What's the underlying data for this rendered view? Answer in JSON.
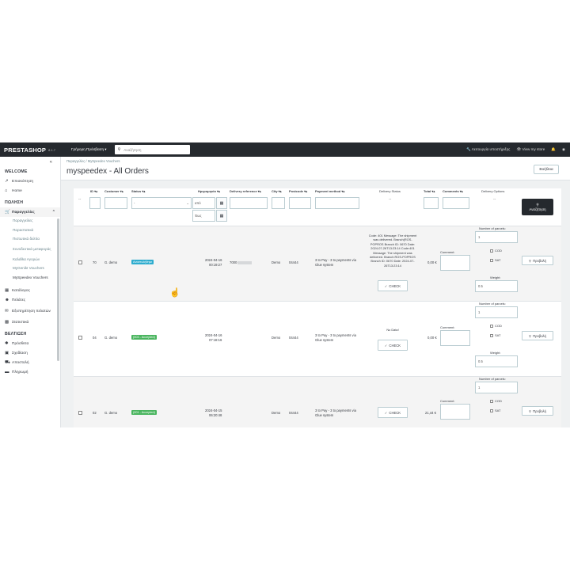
{
  "topbar": {
    "logo": "PRESTASHOP",
    "version": "8.1.7",
    "quick_access": "Γρήγορη Πρόσβαση ▾",
    "search_placeholder": "Αναζήτηση",
    "maintenance": "Λειτουργία υποστήριξης",
    "view_store": "View my store"
  },
  "sidebar": {
    "welcome": "WELCOME",
    "dashboard": "Επισκόπηση",
    "home": "Home",
    "sales": "ΠΩΛΗΣΗ",
    "orders": "Παραγγελίες",
    "order_subs": [
      "Παραγγελίες",
      "Παραστατικά",
      "Πιστωτικά δελτία",
      "Συνοδευτικά μεταφοράς",
      "Καλάθια Αγορών",
      "MyGenikI Vouchers",
      "MySpeedex Vouchers"
    ],
    "catalog": "Κατάλογος",
    "customers": "Πελάτες",
    "customer_service": "Εξυπηρέτηση πελατών",
    "stats": "Στατιστικά",
    "improve": "ΒΕΛΤΙΩΣΗ",
    "modules": "Πρόσθετα",
    "design": "Σχεδίαση",
    "shipping": "Αποστολή",
    "payment": "Πληρωμή"
  },
  "header": {
    "breadcrumb_1": "Παραγγελίες",
    "breadcrumb_2": "MySpeedex Vouchers",
    "title": "myspeedex - All Orders",
    "back": "Βοήθεια"
  },
  "table": {
    "columns": [
      "ID ▾▴",
      "Customer ▾▴",
      "Status ▾▴",
      "Ημερομηνία ▾▴",
      "Delivery reference ▾▴",
      "City ▾▴",
      "Postcode ▾▴",
      "Payment method ▾▴",
      "Delivery Status",
      "Total ▾▴",
      "Comments ▾▴",
      "Delivery Options"
    ],
    "filters": {
      "status_placeholder": "-",
      "date_from": "από",
      "date_to": "Έως",
      "dash": "--",
      "search_label": "Αναζήτηση"
    },
    "rows": [
      {
        "id": "70",
        "customer": "G. demo",
        "status": "Αναστολήθηκε",
        "date": "2024-04-16",
        "time": "00:19:27",
        "ref": "7000",
        "city": "Demo",
        "postcode": "04444",
        "payment_1": "3 to Pay - 3 to payments via",
        "payment_2": "Glue system",
        "delivery_status": [
          "Code: 401 Message: The shipment",
          "was delivered. Branch(ROS-",
          "POPROS Branch ID: 0670 Date:",
          "2024-07-26T13:23:14 Code:401",
          "Message: The shipment was",
          "delivered. Branch:ROS-POPROS",
          "Branch ID: 0670 Date: 2024-07-",
          "26T13:23:14"
        ],
        "check": "CHECK",
        "total": "0,00 €",
        "comment_label": "Comment:",
        "parcels_label": "Number of parcels:",
        "parcels": "1",
        "cod": "COD",
        "sat": "SAT",
        "weight_label": "Weight:",
        "weight": "0.5",
        "print": "Προβολή"
      },
      {
        "id": "04",
        "customer": "G. demo",
        "status": "(003 - Accepted)",
        "date": "2024-04-16",
        "time": "07:18:16",
        "ref": "",
        "city": "Demo",
        "postcode": "04444",
        "payment_1": "3 to Pay - 3 to payments via",
        "payment_2": "Glue system",
        "delivery_status": [
          "No Data!"
        ],
        "check": "CHECK",
        "total": "0,00 €",
        "comment_label": "Comment:",
        "parcels_label": "Number of parcels:",
        "parcels": "1",
        "cod": "COD",
        "sat": "SAT",
        "weight_label": "Weight:",
        "weight": "0.5",
        "print": "Προβολή"
      },
      {
        "id": "02",
        "customer": "G. demo",
        "status": "(001 - Accepted)",
        "date": "2024-04-15",
        "time": "06:20:48",
        "ref": "",
        "city": "Demo",
        "postcode": "04444",
        "payment_1": "3 to Pay - 3 to payments via",
        "payment_2": "Glue system",
        "delivery_status": [],
        "check": "CHECK",
        "total": "21,44 €",
        "comment_label": "Comment:",
        "parcels_label": "Number of parcels:",
        "parcels": "1",
        "cod": "COD",
        "sat": "SAT",
        "weight_label": "",
        "weight": "",
        "print": "Προβολή"
      }
    ]
  }
}
